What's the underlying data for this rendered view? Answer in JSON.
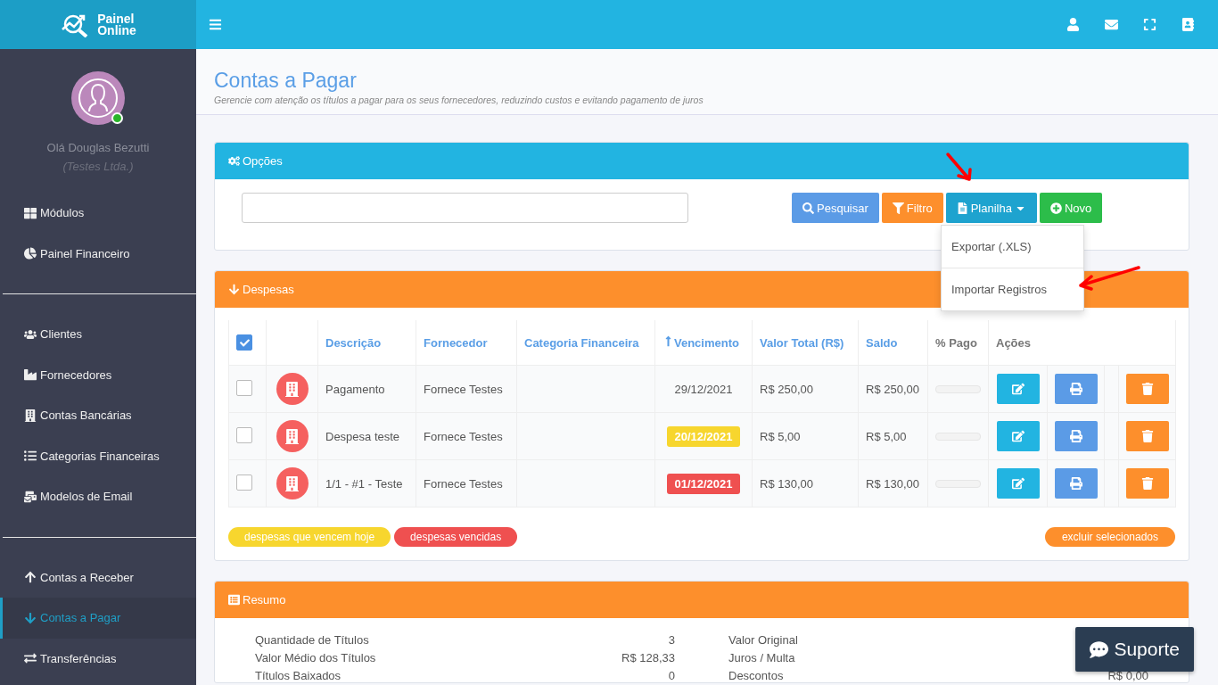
{
  "header": {
    "logo_line1": "Painel",
    "logo_line2": "Online"
  },
  "sidebar": {
    "greeting": "Olá Douglas Bezutti",
    "company": "(Testes Ltda.)",
    "online": true,
    "groups": [
      [
        {
          "label": "Módulos",
          "selected": false
        },
        {
          "label": "Painel Financeiro",
          "selected": false
        }
      ],
      [
        {
          "label": "Clientes",
          "selected": false
        },
        {
          "label": "Fornecedores",
          "selected": false
        },
        {
          "label": "Contas Bancárias",
          "selected": false
        },
        {
          "label": "Categorias Financeiras",
          "selected": false
        },
        {
          "label": "Modelos de Email",
          "selected": false
        }
      ],
      [
        {
          "label": "Contas a Receber",
          "selected": false
        },
        {
          "label": "Contas a Pagar",
          "selected": true
        },
        {
          "label": "Transferências",
          "selected": false
        }
      ]
    ]
  },
  "page": {
    "title": "Contas a Pagar",
    "subtitle": "Gerencie com atenção os títulos a pagar para os seus fornecedores, reduzindo custos e evitando pagamento de juros"
  },
  "options": {
    "title": "Opções",
    "buttons": [
      {
        "label": "Pesquisar",
        "kind": "search"
      },
      {
        "label": "Filtro",
        "kind": "filter"
      },
      {
        "label": "Planilha",
        "kind": "dropdown"
      },
      {
        "label": "Novo",
        "kind": "new"
      }
    ],
    "menu": [
      "Exportar (.XLS)",
      "Importar Registros"
    ]
  },
  "expenses": {
    "title": "Despesas",
    "select_all": true,
    "columns": [
      {
        "label": "Descrição",
        "sortable": true,
        "sorted": false
      },
      {
        "label": "Fornecedor",
        "sortable": true,
        "sorted": false
      },
      {
        "label": "Categoria Financeira",
        "sortable": true,
        "sorted": false
      },
      {
        "label": "Vencimento",
        "sortable": true,
        "sorted": true
      },
      {
        "label": "Valor Total (R$)",
        "sortable": true,
        "sorted": false
      },
      {
        "label": "Saldo",
        "sortable": true,
        "sorted": false
      },
      {
        "label": "% Pago",
        "sortable": false,
        "sorted": false
      },
      {
        "label": "Ações",
        "sortable": false,
        "sorted": false
      }
    ],
    "rows": [
      {
        "checked": false,
        "description": "Pagamento",
        "supplier": "Fornece Testes",
        "due": "29/12/2021",
        "due_today": false,
        "overdue": false,
        "total": "R$ 250,00",
        "balance": "R$ 250,00",
        "level": 0
      },
      {
        "checked": false,
        "description": "Despesa teste",
        "supplier": "Fornece Testes",
        "due": "20/12/2021",
        "due_today": true,
        "overdue": false,
        "total": "R$ 5,00",
        "balance": "R$ 5,00",
        "level": 0
      },
      {
        "checked": false,
        "description": "1/1 - #1 - Teste",
        "supplier": "Fornece Testes",
        "due": "01/12/2021",
        "due_today": false,
        "overdue": true,
        "total": "R$ 130,00",
        "balance": "R$ 130,00",
        "level": 0
      }
    ],
    "legends": [
      {
        "label": "despesas que vencem hoje",
        "color": "#f7d62e"
      },
      {
        "label": "despesas vencidas",
        "color": "#ef5050"
      }
    ],
    "delete_selected": "excluir selecionados"
  },
  "summary": {
    "title": "Resumo",
    "left": [
      {
        "label": "Quantidade de Títulos",
        "value": "3"
      },
      {
        "label": "Valor Médio dos Títulos",
        "value": "R$ 128,33"
      },
      {
        "label": "Títulos Baixados",
        "value": "0"
      }
    ],
    "right": [
      {
        "label": "Valor Original"
      },
      {
        "label": "Juros / Multa"
      },
      {
        "label": "Descontos",
        "value": "R$ 0,00"
      }
    ]
  },
  "support": "Suporte"
}
